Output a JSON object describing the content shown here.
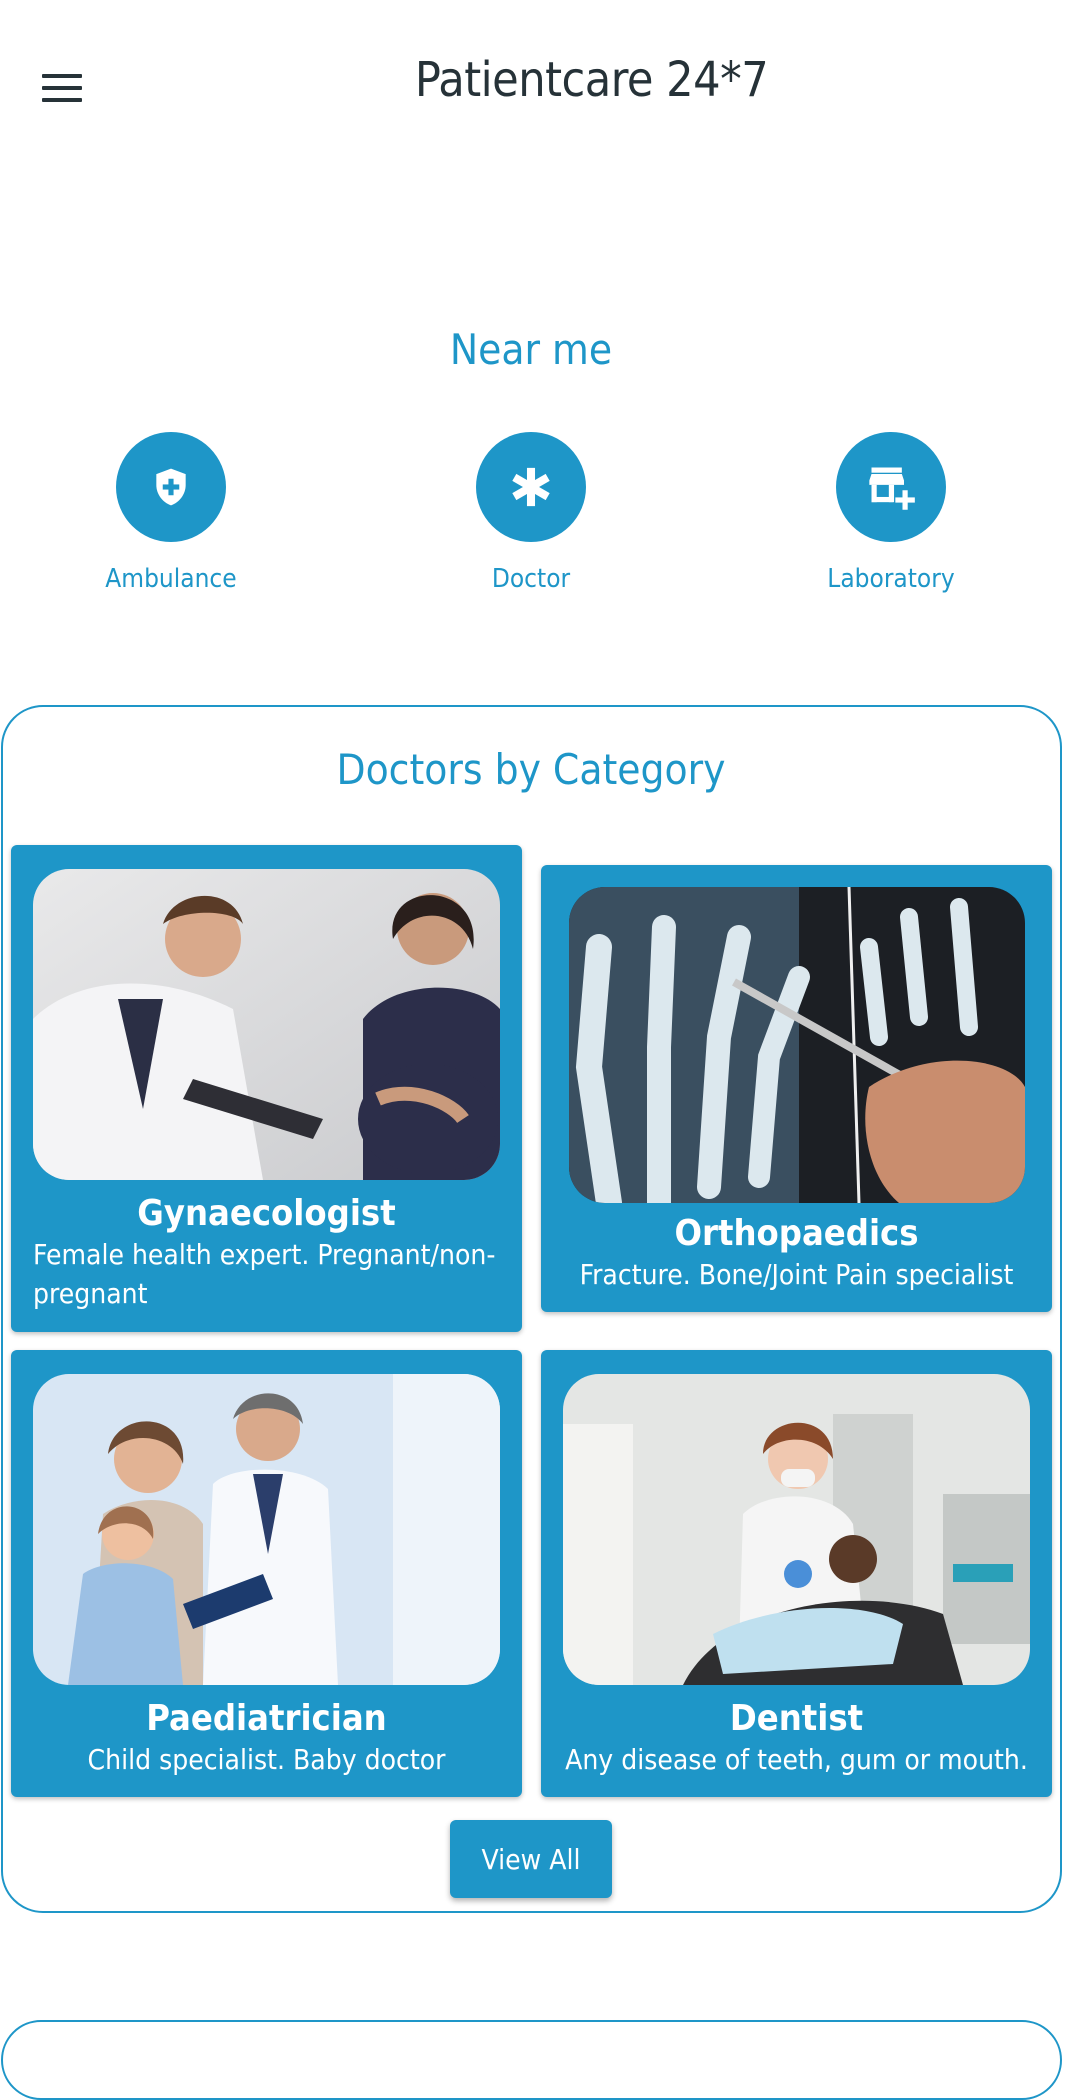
{
  "header": {
    "title": "Patientcare 24*7"
  },
  "near_me": {
    "title": "Near me",
    "items": [
      {
        "label": "Ambulance",
        "icon": "shield-plus-icon"
      },
      {
        "label": "Doctor",
        "icon": "asterisk-icon"
      },
      {
        "label": "Laboratory",
        "icon": "store-plus-icon"
      }
    ]
  },
  "categories": {
    "title": "Doctors by Category",
    "items": [
      {
        "name": "Gynaecologist",
        "description": "Female health expert. Pregnant/non-pregnant"
      },
      {
        "name": "Orthopaedics",
        "description": "Fracture. Bone/Joint Pain specialist"
      },
      {
        "name": "Paediatrician",
        "description": "Child specialist. Baby doctor"
      },
      {
        "name": "Dentist",
        "description": "Any disease of teeth, gum or mouth."
      }
    ],
    "view_all_label": "View All"
  },
  "colors": {
    "accent": "#1e96c8",
    "title_text": "#263238"
  }
}
